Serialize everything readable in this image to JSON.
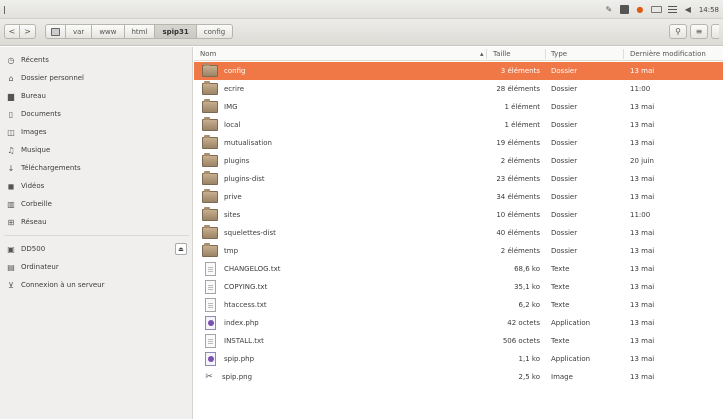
{
  "system": {
    "clock": "14:58",
    "tray_icons": [
      "screenshot-icon",
      "image-icon",
      "ubuntuone-icon",
      "mail-icon",
      "network-icon",
      "volume-icon"
    ]
  },
  "toolbar": {
    "back": "<",
    "forward": ">",
    "breadcrumb": [
      "var",
      "www",
      "html",
      "spip31",
      "config"
    ],
    "active_crumb": "spip31",
    "search_icon": "search-icon",
    "view_icon": "list-view-icon",
    "menu_icon": "menu-icon"
  },
  "sidebar": {
    "items": [
      {
        "label": "Récents",
        "icon": "clock-icon"
      },
      {
        "label": "Dossier personnel",
        "icon": "home-icon"
      },
      {
        "label": "Bureau",
        "icon": "desktop-icon"
      },
      {
        "label": "Documents",
        "icon": "documents-icon"
      },
      {
        "label": "Images",
        "icon": "images-icon"
      },
      {
        "label": "Musique",
        "icon": "music-icon"
      },
      {
        "label": "Téléchargements",
        "icon": "download-icon"
      },
      {
        "label": "Vidéos",
        "icon": "video-icon"
      },
      {
        "label": "Corbeille",
        "icon": "trash-icon"
      },
      {
        "label": "Réseau",
        "icon": "network-icon"
      }
    ],
    "devices": [
      {
        "label": "DD500",
        "icon": "drive-icon",
        "eject": true
      },
      {
        "label": "Ordinateur",
        "icon": "computer-icon"
      },
      {
        "label": "Connexion à un serveur",
        "icon": "server-icon"
      }
    ]
  },
  "columns": {
    "name": "Nom",
    "size": "Taille",
    "type": "Type",
    "modified": "Dernière modification"
  },
  "files": [
    {
      "name": "config",
      "size": "3 éléments",
      "type": "Dossier",
      "modified": "13 mai",
      "kind": "folder",
      "selected": true
    },
    {
      "name": "ecrire",
      "size": "28 éléments",
      "type": "Dossier",
      "modified": "11:00",
      "kind": "folder"
    },
    {
      "name": "IMG",
      "size": "1 élément",
      "type": "Dossier",
      "modified": "13 mai",
      "kind": "folder"
    },
    {
      "name": "local",
      "size": "1 élément",
      "type": "Dossier",
      "modified": "13 mai",
      "kind": "folder"
    },
    {
      "name": "mutualisation",
      "size": "19 éléments",
      "type": "Dossier",
      "modified": "13 mai",
      "kind": "folder"
    },
    {
      "name": "plugins",
      "size": "2 éléments",
      "type": "Dossier",
      "modified": "20 juin",
      "kind": "folder"
    },
    {
      "name": "plugins-dist",
      "size": "23 éléments",
      "type": "Dossier",
      "modified": "13 mai",
      "kind": "folder"
    },
    {
      "name": "prive",
      "size": "34 éléments",
      "type": "Dossier",
      "modified": "13 mai",
      "kind": "folder"
    },
    {
      "name": "sites",
      "size": "10 éléments",
      "type": "Dossier",
      "modified": "11:00",
      "kind": "folder"
    },
    {
      "name": "squelettes-dist",
      "size": "40 éléments",
      "type": "Dossier",
      "modified": "13 mai",
      "kind": "folder"
    },
    {
      "name": "tmp",
      "size": "2 éléments",
      "type": "Dossier",
      "modified": "13 mai",
      "kind": "folder"
    },
    {
      "name": "CHANGELOG.txt",
      "size": "68,6 ko",
      "type": "Texte",
      "modified": "13 mai",
      "kind": "text"
    },
    {
      "name": "COPYING.txt",
      "size": "35,1 ko",
      "type": "Texte",
      "modified": "13 mai",
      "kind": "text"
    },
    {
      "name": "htaccess.txt",
      "size": "6,2 ko",
      "type": "Texte",
      "modified": "13 mai",
      "kind": "text"
    },
    {
      "name": "index.php",
      "size": "42 octets",
      "type": "Application",
      "modified": "13 mai",
      "kind": "php"
    },
    {
      "name": "INSTALL.txt",
      "size": "506 octets",
      "type": "Texte",
      "modified": "13 mai",
      "kind": "text"
    },
    {
      "name": "spip.php",
      "size": "1,1 ko",
      "type": "Application",
      "modified": "13 mai",
      "kind": "php"
    },
    {
      "name": "spip.png",
      "size": "2,5 ko",
      "type": "Image",
      "modified": "13 mai",
      "kind": "image"
    }
  ],
  "colors": {
    "selection": "#f07746",
    "sidebar_bg": "#f0efed"
  }
}
